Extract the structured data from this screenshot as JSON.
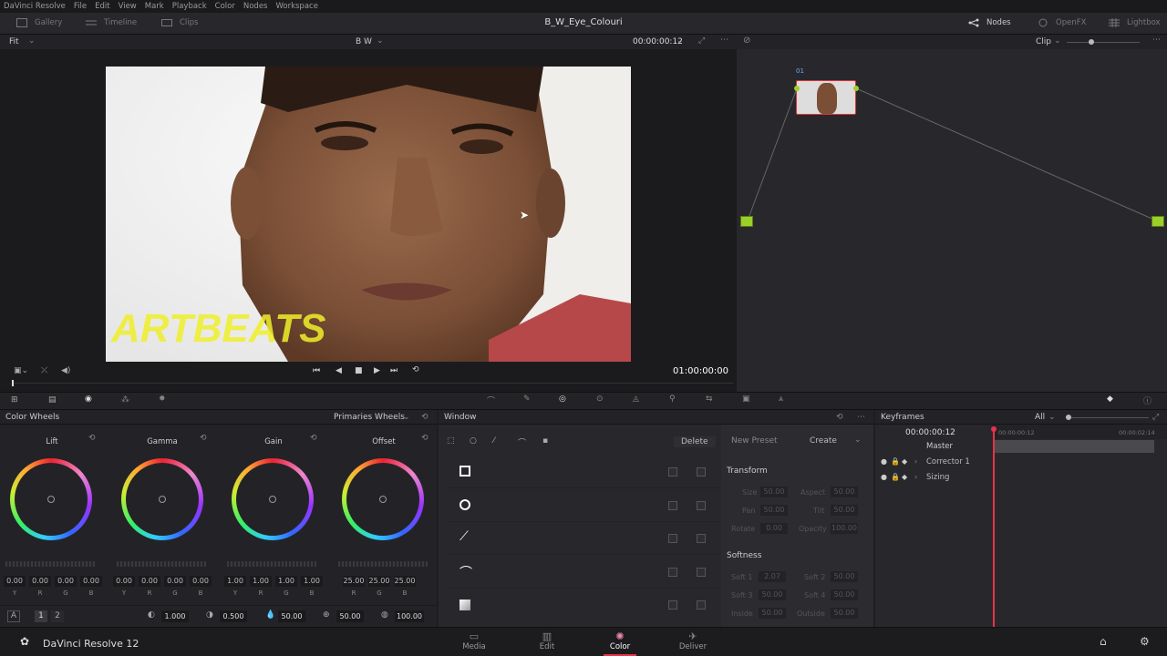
{
  "menu": [
    "DaVinci Resolve",
    "File",
    "Edit",
    "View",
    "Mark",
    "Playback",
    "Color",
    "Nodes",
    "Workspace"
  ],
  "toolbar": {
    "gallery": "Gallery",
    "timeline": "Timeline",
    "clips": "Clips",
    "project_title": "B_W_Eye_Colouri",
    "nodes": "Nodes",
    "openfx": "OpenFX",
    "lightbox": "Lightbox"
  },
  "viewer": {
    "fit": "Fit",
    "clip_name": "B W",
    "timecode": "00:00:00:12",
    "transport_timecode": "01:00:00:00",
    "watermark": "ARTBEATS"
  },
  "node_panel": {
    "mode": "Clip",
    "node_label": "01"
  },
  "color_wheels": {
    "title": "Color Wheels",
    "mode": "Primaries Wheels",
    "wheels": [
      {
        "name": "Lift",
        "values": [
          "0.00",
          "0.00",
          "0.00",
          "0.00"
        ]
      },
      {
        "name": "Gamma",
        "values": [
          "0.00",
          "0.00",
          "0.00",
          "0.00"
        ]
      },
      {
        "name": "Gain",
        "values": [
          "1.00",
          "1.00",
          "1.00",
          "1.00"
        ]
      },
      {
        "name": "Offset",
        "values": [
          "25.00",
          "25.00",
          "25.00"
        ]
      }
    ],
    "channels4": [
      "Y",
      "R",
      "G",
      "B"
    ],
    "channels3": [
      "R",
      "G",
      "B"
    ],
    "page_a": "A",
    "page_1": "1",
    "page_2": "2",
    "contrast": "1.000",
    "pivot": "0.500",
    "sat": "50.00",
    "hue": "50.00",
    "lum_mix": "100.00"
  },
  "window_panel": {
    "title": "Window",
    "delete": "Delete",
    "new_preset": "New Preset",
    "create": "Create",
    "transform": "Transform",
    "softness": "Softness",
    "transform_fields": [
      {
        "label": "Size",
        "value": "50.00"
      },
      {
        "label": "Aspect",
        "value": "50.00"
      },
      {
        "label": "Pan",
        "value": "50.00"
      },
      {
        "label": "Tilt",
        "value": "50.00"
      },
      {
        "label": "Rotate",
        "value": "0.00"
      },
      {
        "label": "Opacity",
        "value": "100.00"
      }
    ],
    "softness_fields": [
      {
        "label": "Soft 1",
        "value": "2.07"
      },
      {
        "label": "Soft 2",
        "value": "50.00"
      },
      {
        "label": "Soft 3",
        "value": "50.00"
      },
      {
        "label": "Soft 4",
        "value": "50.00"
      },
      {
        "label": "Inside",
        "value": "50.00"
      },
      {
        "label": "Outside",
        "value": "50.00"
      }
    ]
  },
  "keyframes": {
    "title": "Keyframes",
    "filter": "All",
    "timecode": "00:00:00:12",
    "ruler_start": "00:00:00:12",
    "ruler_end": "00:00:02:14",
    "master": "Master",
    "tracks": [
      "Corrector 1",
      "Sizing"
    ]
  },
  "bottom": {
    "app": "DaVinci Resolve 12",
    "nav": [
      "Media",
      "Edit",
      "Color",
      "Deliver"
    ],
    "active": "Color"
  },
  "colors": {
    "accent": "#e8334a",
    "node_green": "#9bd02a"
  }
}
